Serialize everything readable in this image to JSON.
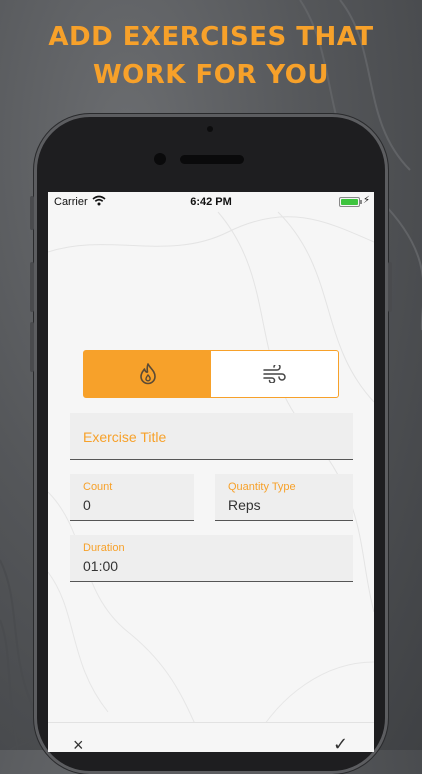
{
  "headline": {
    "line1": "ADD EXERCISES THAT",
    "line2": "WORK FOR YOU"
  },
  "status_bar": {
    "carrier": "Carrier",
    "time": "6:42 PM",
    "battery_level": 1.0
  },
  "toggle": {
    "options": [
      {
        "icon": "flame-icon",
        "active": true
      },
      {
        "icon": "wind-icon",
        "active": false
      }
    ]
  },
  "form": {
    "title_placeholder": "Exercise Title",
    "count_label": "Count",
    "count_value": "0",
    "quantity_type_label": "Quantity Type",
    "quantity_type_value": "Reps",
    "duration_label": "Duration",
    "duration_value": "01:00"
  },
  "bottom_bar": {
    "close_symbol": "×",
    "confirm_symbol": "✓"
  },
  "colors": {
    "accent": "#f7a12a",
    "background": "#55575a",
    "screen": "#f6f6f6"
  }
}
